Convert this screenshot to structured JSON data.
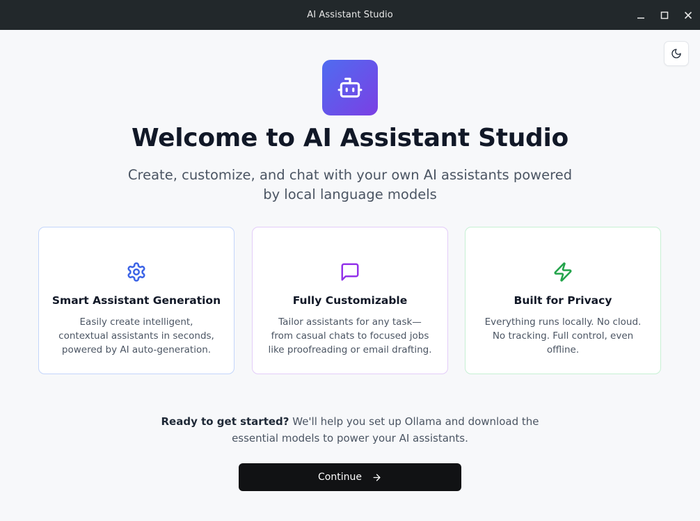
{
  "window": {
    "title": "AI Assistant Studio",
    "controls": [
      "minimize-icon",
      "maximize-icon",
      "close-icon"
    ]
  },
  "theme_toggle": {
    "icon": "moon-icon"
  },
  "logo": {
    "icon": "robot-icon",
    "gradient": [
      "#4f6cf0",
      "#7b3fe4"
    ]
  },
  "hero": {
    "title": "Welcome to AI Assistant Studio",
    "subtitle": "Create, customize, and chat with your own AI assistants powered by local language models"
  },
  "features": [
    {
      "icon": "gear-icon",
      "icon_color": "#3b63e6",
      "title": "Smart Assistant Generation",
      "description": "Easily create intelligent, contextual assistants in seconds, powered by AI auto-generation."
    },
    {
      "icon": "chat-bubble-icon",
      "icon_color": "#9333ea",
      "title": "Fully Customizable",
      "description": "Tailor assistants for any task—from casual chats to focused jobs like proofreading or email drafting."
    },
    {
      "icon": "lightning-icon",
      "icon_color": "#22a34a",
      "title": "Built for Privacy",
      "description": "Everything runs locally. No cloud. No tracking. Full control, even offline."
    }
  ],
  "ready": {
    "bold": "Ready to get started?",
    "text": " We'll help you set up Ollama and download the essential models to power your AI assistants."
  },
  "continue_button": {
    "label": "Continue",
    "icon": "arrow-right-icon"
  },
  "colors": {
    "titlebar": "#22282b",
    "background": "#f7f8fa",
    "button": "#111214"
  }
}
